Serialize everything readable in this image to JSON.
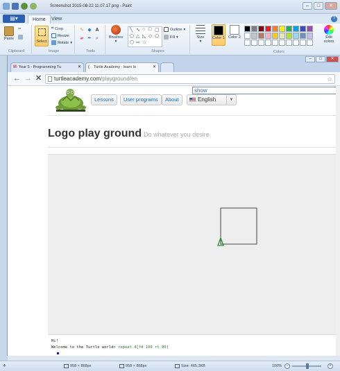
{
  "paint": {
    "title": "Screenshot 2015-08-22 11.07.17.png - Paint",
    "tabs": [
      "Home",
      "View"
    ],
    "clipboard": {
      "paste": "Paste",
      "cut": "Cut",
      "copy": "Copy",
      "label": "Clipboard"
    },
    "image": {
      "select": "Select",
      "crop": "Crop",
      "resize": "Resize",
      "rotate": "Rotate",
      "label": "Image"
    },
    "tools": {
      "label": "Tools"
    },
    "brushes": "Brushes",
    "shapes": {
      "outline": "Outline",
      "fill": "Fill",
      "label": "Shapes"
    },
    "size": "Size",
    "color1": "Color 1",
    "color2": "Color 2",
    "colors_label": "Colors",
    "edit_colors": "Edit colors",
    "color1_value": "#000000",
    "color2_value": "#ffffff",
    "palette": [
      "#000000",
      "#7f7f7f",
      "#880015",
      "#ed1c24",
      "#ff7f27",
      "#fff200",
      "#22b14c",
      "#00a2e8",
      "#3f48cc",
      "#a349a4",
      "#ffffff",
      "#c3c3c3",
      "#b97a57",
      "#ffaec9",
      "#ffc90e",
      "#efe4b0",
      "#b5e61d",
      "#99d9ea",
      "#7092be",
      "#c8bfe7",
      "#ffffff",
      "#ffffff",
      "#ffffff",
      "#ffffff",
      "#ffffff",
      "#ffffff",
      "#ffffff",
      "#ffffff",
      "#ffffff",
      "#ffffff"
    ],
    "status": {
      "dims1": "958 × 868px",
      "dims2": "958 × 868px",
      "size": "Size: 465.3KB",
      "zoom": "100%"
    }
  },
  "browser": {
    "tabs": [
      {
        "label": "Year 5 - Programming Tu",
        "active": false
      },
      {
        "label": "Turtle Academy - learn lo",
        "active": true
      }
    ],
    "url_host": "turtleacademy.com",
    "url_path": "/playground/en"
  },
  "page": {
    "nav": [
      "Lessons",
      "User programs",
      "About"
    ],
    "search_value": "show",
    "language": "English",
    "title": "Logo play ground",
    "subtitle": "Do whatever you desire",
    "console": {
      "hi": "Hi!",
      "welcome": "Welcome to the Turtle world",
      "prompt": ">",
      "command": "repeat 4[fd 100 rt 90]"
    }
  }
}
